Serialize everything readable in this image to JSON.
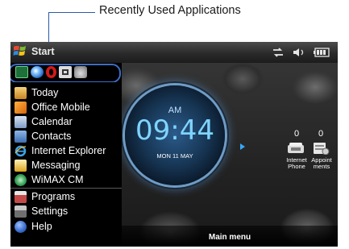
{
  "callout": {
    "label": "Recently Used Applications"
  },
  "titlebar": {
    "start_label": "Start"
  },
  "recent_apps": [
    {
      "icon": "app-green-icon",
      "color": "#3aa35a"
    },
    {
      "icon": "app-blue-orb-icon",
      "color": "#2e7bd6"
    },
    {
      "icon": "app-opera-icon",
      "color": "#d41a1a"
    },
    {
      "icon": "app-camera-icon",
      "color": "#aaaaaa"
    },
    {
      "icon": "app-phone-icon",
      "color": "#bbbbbb"
    }
  ],
  "menu": {
    "items": [
      {
        "label": "Today",
        "icon": "today-icon",
        "color": "#d8a23b"
      },
      {
        "label": "Office Mobile",
        "icon": "office-icon",
        "color": "#e58a1c"
      },
      {
        "label": "Calendar",
        "icon": "calendar-icon",
        "color": "#9db5d6"
      },
      {
        "label": "Contacts",
        "icon": "contacts-icon",
        "color": "#5c8fc8"
      },
      {
        "label": "Internet Explorer",
        "icon": "internet-explorer-icon",
        "color": "#3ea2e8"
      },
      {
        "label": "Messaging",
        "icon": "messaging-icon",
        "color": "#e8c14a"
      },
      {
        "label": "WiMAX CM",
        "icon": "wimax-icon",
        "color": "#3aa35a"
      },
      {
        "label": "Programs",
        "icon": "programs-icon",
        "color": "#c44a4a"
      },
      {
        "label": "Settings",
        "icon": "settings-icon",
        "color": "#8c8c8c"
      },
      {
        "label": "Help",
        "icon": "help-icon",
        "color": "#3d6fd0"
      }
    ]
  },
  "clock": {
    "ampm": "AM",
    "time": "09:44",
    "date": "MON 11 MAY"
  },
  "quick_apps": [
    {
      "count": "0",
      "label_line1": "Internet",
      "label_line2": "Phone",
      "icon": "internet-phone-icon"
    },
    {
      "count": "0",
      "label_line1": "Appoint",
      "label_line2": "ments",
      "icon": "appointments-icon"
    }
  ],
  "bottom": {
    "main_menu": "Main menu"
  },
  "colors": {
    "highlight": "#3e6cc4",
    "clock": "#7fd4ff",
    "arrow": "#32a9ff"
  }
}
